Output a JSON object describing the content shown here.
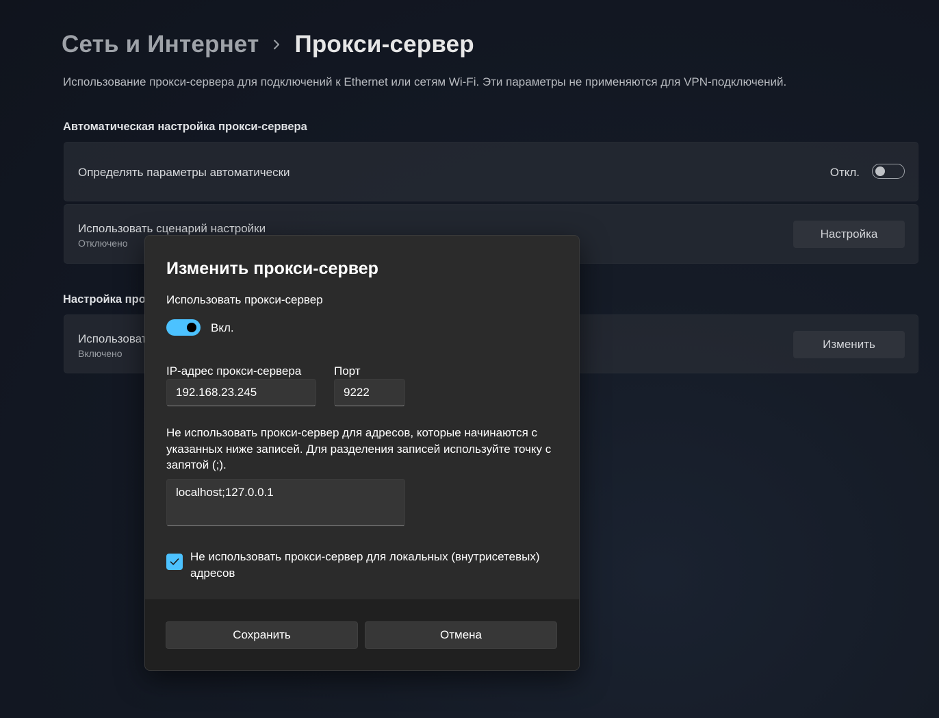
{
  "breadcrumb": {
    "parent": "Сеть и Интернет",
    "current": "Прокси-сервер"
  },
  "description": "Использование прокси-сервера для подключений к Ethernet или сетям Wi-Fi. Эти параметры не применяются для VPN-подключений.",
  "auto_section": {
    "heading": "Автоматическая настройка прокси-сервера",
    "detect": {
      "title": "Определять параметры автоматически",
      "state_label": "Откл.",
      "enabled": false
    },
    "script": {
      "title": "Использовать сценарий настройки",
      "status": "Отключено",
      "button": "Настройка"
    }
  },
  "manual_section": {
    "heading": "Настройка про",
    "row": {
      "title": "Использоват",
      "status": "Включено",
      "button": "Изменить"
    }
  },
  "dialog": {
    "title": "Изменить прокси-сервер",
    "use_proxy_label": "Использовать прокси-сервер",
    "toggle_label": "Вкл.",
    "toggle_on": true,
    "ip_label": "IP-адрес прокси-сервера",
    "ip_value": "192.168.23.245",
    "port_label": "Порт",
    "port_value": "9222",
    "exceptions_text": "Не использовать прокси-сервер для адресов, которые начинаются с указанных ниже записей. Для разделения записей используйте точку с запятой (;).",
    "exceptions_value": "localhost;127.0.0.1",
    "local_checkbox_label": "Не использовать прокси-сервер для локальных (внутрисетевых) адресов",
    "local_checked": true,
    "save_button": "Сохранить",
    "cancel_button": "Отмена"
  },
  "colors": {
    "accent": "#4cc2ff",
    "dialog_bg": "#2b2b2b",
    "footer_bg": "#202020"
  },
  "icons": [
    "chevron-right-icon",
    "checkmark-icon"
  ]
}
